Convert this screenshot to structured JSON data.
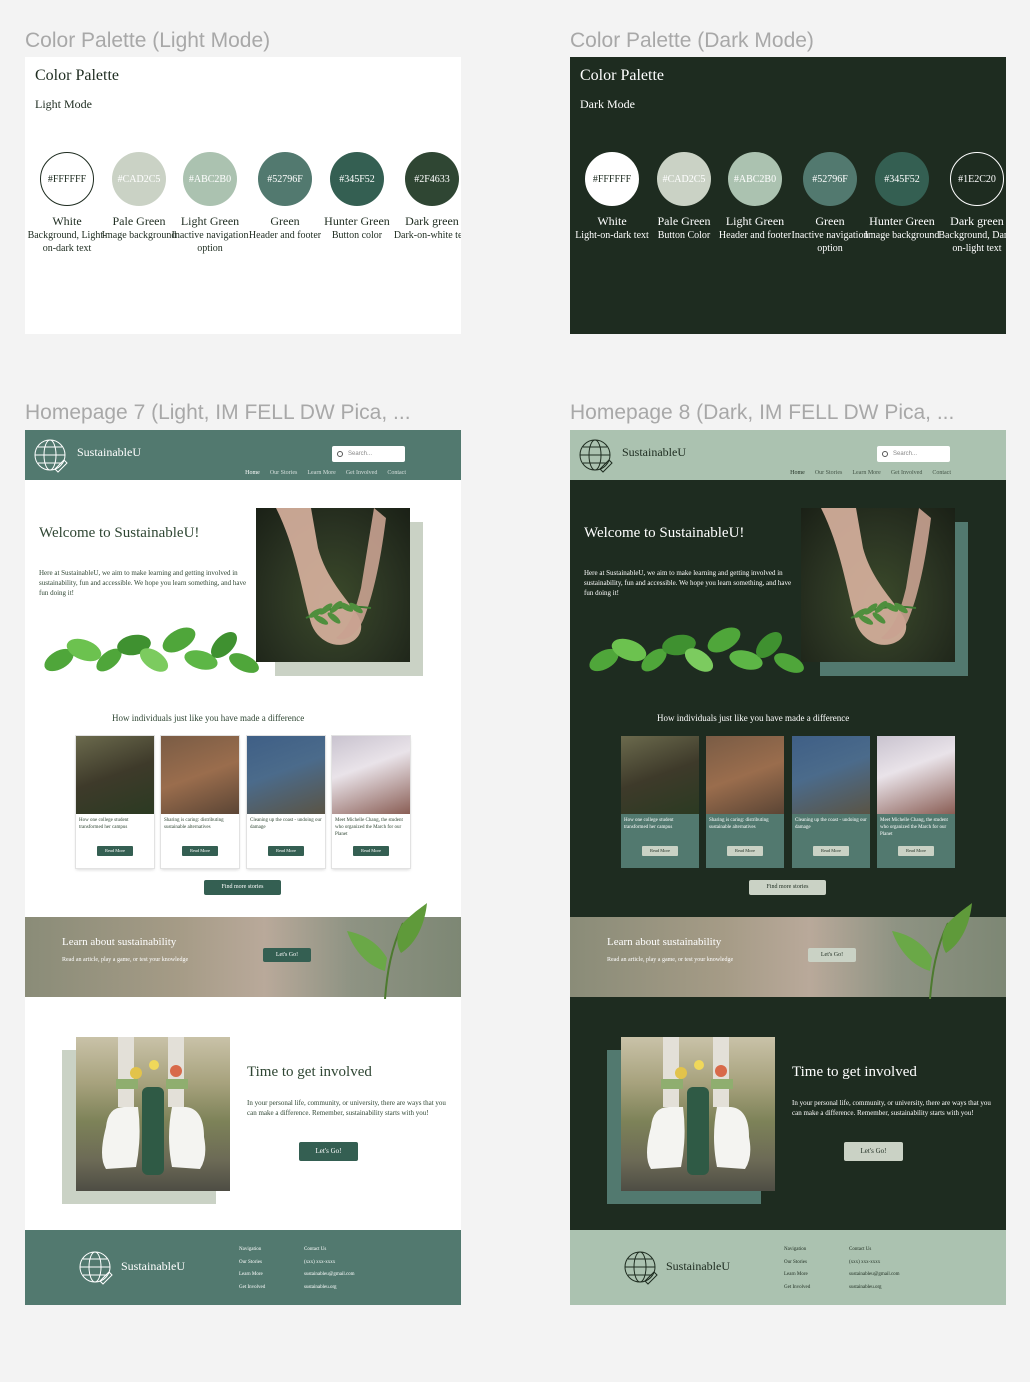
{
  "labels": {
    "palette_light": "Color Palette (Light Mode)",
    "palette_dark": "Color Palette (Dark Mode)",
    "homepage_light": "Homepage 7 (Light, IM FELL DW Pica, ...",
    "homepage_dark": "Homepage 8 (Dark, IM FELL DW Pica, ..."
  },
  "palette_light": {
    "title": "Color Palette",
    "subtitle": "Light Mode",
    "swatches": [
      {
        "hex": "#FFFFFF",
        "name": "White",
        "desc": "Background, Light-on-dark text",
        "color": "#FFFFFF",
        "text": "#1E2C20"
      },
      {
        "hex": "#CAD2C5",
        "name": "Pale Green",
        "desc": "Image background",
        "color": "#CAD2C5",
        "text": "#ffffff"
      },
      {
        "hex": "#ABC2B0",
        "name": "Light Green",
        "desc": "Inactive navigation option",
        "color": "#ABC2B0",
        "text": "#ffffff"
      },
      {
        "hex": "#52796F",
        "name": "Green",
        "desc": "Header and footer",
        "color": "#52796F",
        "text": "#ffffff"
      },
      {
        "hex": "#345F52",
        "name": "Hunter Green",
        "desc": "Button color",
        "color": "#345F52",
        "text": "#ffffff"
      },
      {
        "hex": "#2F4633",
        "name": "Dark green",
        "desc": "Dark-on-white text",
        "color": "#2F4633",
        "text": "#ffffff"
      }
    ]
  },
  "palette_dark": {
    "title": "Color Palette",
    "subtitle": "Dark Mode",
    "swatches": [
      {
        "hex": "#FFFFFF",
        "name": "White",
        "desc": "Light-on-dark text",
        "color": "#FFFFFF",
        "text": "#1E2C20"
      },
      {
        "hex": "#CAD2C5",
        "name": "Pale Green",
        "desc": "Button Color",
        "color": "#CAD2C5",
        "text": "#ffffff"
      },
      {
        "hex": "#ABC2B0",
        "name": "Light Green",
        "desc": "Header and footer",
        "color": "#ABC2B0",
        "text": "#ffffff"
      },
      {
        "hex": "#52796F",
        "name": "Green",
        "desc": "Inactive navigation option",
        "color": "#52796F",
        "text": "#ffffff"
      },
      {
        "hex": "#345F52",
        "name": "Hunter Green",
        "desc": "Image background",
        "color": "#345F52",
        "text": "#ffffff"
      },
      {
        "hex": "#1E2C20",
        "name": "Dark green",
        "desc": "Background, Dark-on-light text",
        "color": "#1E2C20",
        "text": "#ffffff"
      }
    ]
  },
  "site": {
    "brand": "SustainableU",
    "search_placeholder": "Search...",
    "nav": [
      "Home",
      "Our Stories",
      "Learn More",
      "Get Involved",
      "Contact"
    ],
    "welcome_title": "Welcome to SustainableU!",
    "welcome_text": "Here at SustainableU, we aim to make learning and getting involved in sustainability, fun and accessible. We hope you learn something, and have fun doing it!",
    "stories_title": "How individuals just like you have made a difference",
    "stories": [
      {
        "text": "How one college student transformed her campus",
        "button": "Read More"
      },
      {
        "text": "Sharing is caring: distributing sustainable alternatives",
        "button": "Read More"
      },
      {
        "text": "Cleaning up the coast - undoing our damage",
        "button": "Read More"
      },
      {
        "text": "Meet Michelle Chang, the student who organized the March for our Planet",
        "button": "Read More"
      }
    ],
    "find_more": "Find more stories",
    "learn_title": "Learn about sustainability",
    "learn_sub": "Read an article, play a game, or test your knowledge",
    "learn_button": "Let's Go!",
    "involved_title": "Time to get involved",
    "involved_text": "In your personal life, community, or university, there are ways that you can make a difference. Remember, sustainability starts with you!",
    "involved_button": "Let's Go!",
    "footer": {
      "nav_title": "Navigation",
      "nav_items": [
        "Our Stories",
        "Learn More",
        "Get Involved"
      ],
      "contact_title": "Contact Us",
      "contact_items": [
        "(xxx) xxx-xxxx",
        "sustainableu@gmail.com",
        "sustainableu.org"
      ]
    }
  }
}
